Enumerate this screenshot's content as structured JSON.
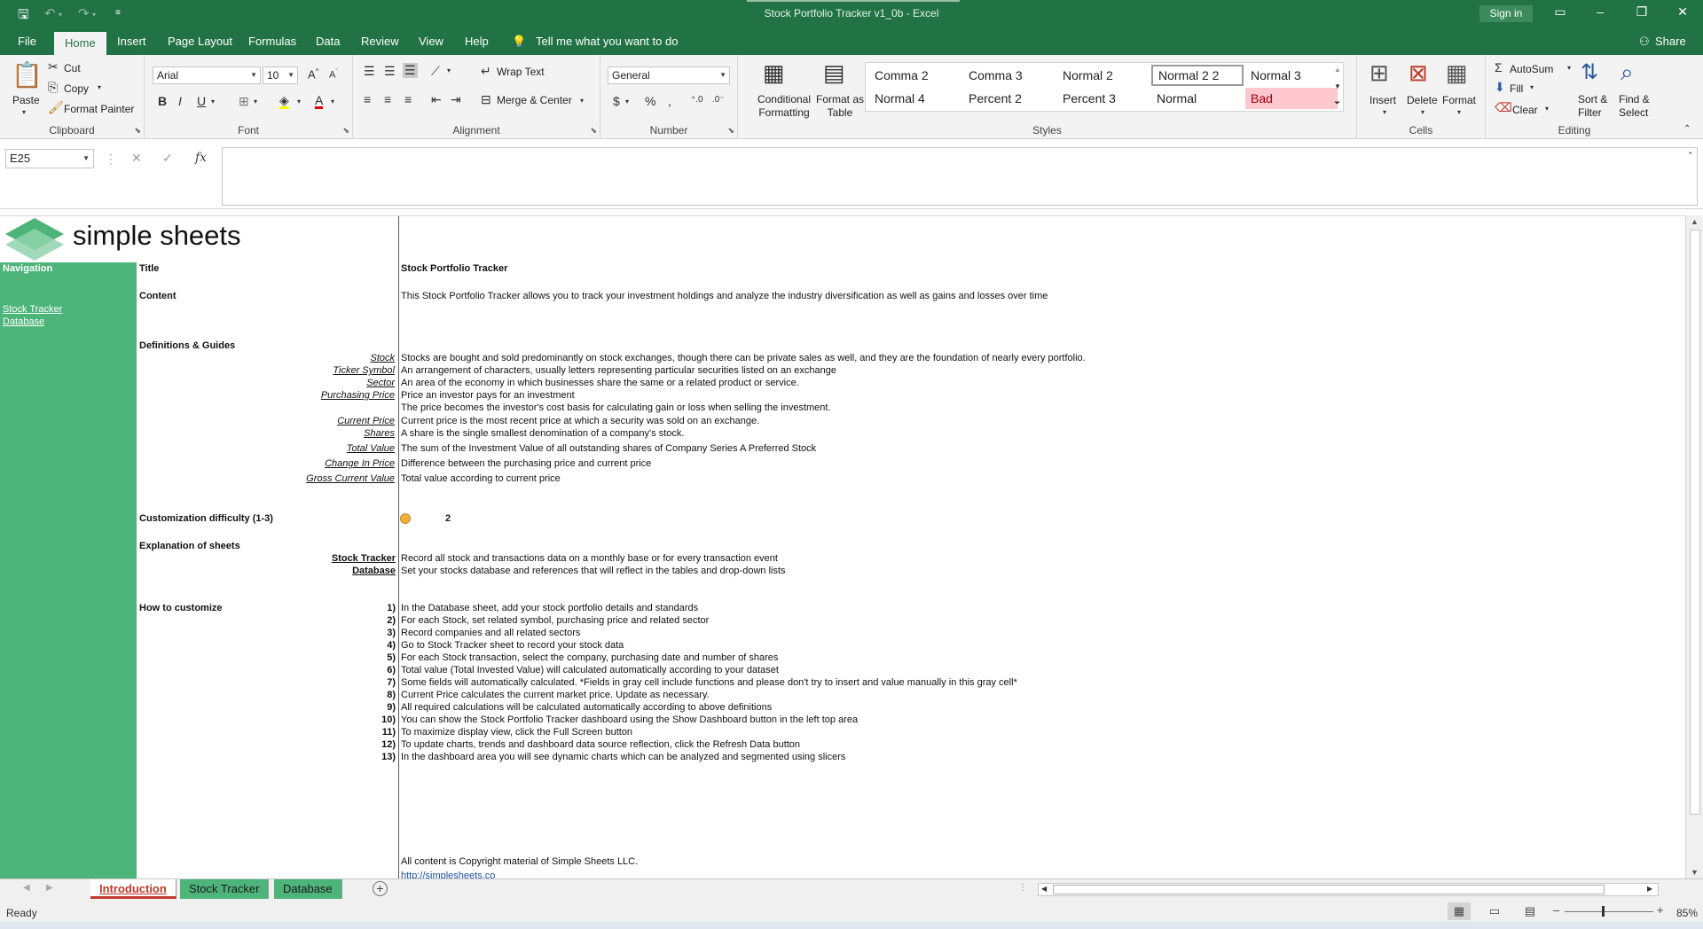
{
  "window": {
    "title": "Stock Portfolio Tracker v1_0b  -  Excel",
    "signin": "Sign in"
  },
  "tabs": [
    "File",
    "Home",
    "Insert",
    "Page Layout",
    "Formulas",
    "Data",
    "Review",
    "View",
    "Help"
  ],
  "tell_me": "Tell me what you want to do",
  "share": "Share",
  "ribbon": {
    "clipboard": {
      "paste": "Paste",
      "cut": "Cut",
      "copy": "Copy",
      "format_painter": "Format Painter",
      "label": "Clipboard"
    },
    "font": {
      "name": "Arial",
      "size": "10",
      "label": "Font"
    },
    "alignment": {
      "wrap_text": "Wrap Text",
      "merge_center": "Merge & Center",
      "label": "Alignment"
    },
    "number": {
      "format": "General",
      "label": "Number"
    },
    "styles": {
      "conditional": "Conditional Formatting",
      "format_table": "Format as Table",
      "items": [
        "Comma 2",
        "Comma 3",
        "Normal 2",
        "Normal 2 2",
        "Normal 3",
        "Normal 4",
        "Percent 2",
        "Percent 3",
        "Normal",
        "Bad"
      ],
      "label": "Styles"
    },
    "cells": {
      "insert": "Insert",
      "delete": "Delete",
      "format": "Format",
      "label": "Cells"
    },
    "editing": {
      "autosum": "AutoSum",
      "fill": "Fill",
      "clear": "Clear",
      "sort_filter": "Sort & Filter",
      "find_select": "Find & Select",
      "label": "Editing"
    }
  },
  "formula_bar": {
    "name_box": "E25",
    "formula": ""
  },
  "sheet": {
    "brand": "simple sheets",
    "navigation": {
      "heading": "Navigation",
      "links": [
        "Stock Tracker",
        "Database"
      ]
    },
    "title_label": "Title",
    "title_value": "Stock Portfolio Tracker",
    "content_label": "Content",
    "content_value": "This Stock Portfolio Tracker allows you to track your investment holdings and analyze the industry diversification as well as gains and losses over time",
    "definitions_label": "Definitions & Guides",
    "definitions": [
      {
        "term": "Stock",
        "text": "Stocks are bought and sold predominantly on stock exchanges, though there can be private sales as well, and they are the foundation of nearly every portfolio."
      },
      {
        "term": "Ticker Symbol",
        "text": "An arrangement of characters, usually letters representing particular securities listed on an exchange"
      },
      {
        "term": "Sector",
        "text": "An area of the economy in which businesses share the same or a related product or service."
      },
      {
        "term": "Purchasing Price",
        "text": "Price an investor pays for an investment"
      },
      {
        "term": "",
        "text": "The price becomes the investor's cost basis for calculating gain or loss when selling the investment."
      },
      {
        "term": "Current Price",
        "text": "Current price is the most recent price at which a security was sold on an exchange."
      },
      {
        "term": "Shares",
        "text": "A share is the single smallest denomination of a company's stock."
      },
      {
        "term": "Total Value",
        "text": "The sum of the Investment Value of all outstanding shares of Company Series A Preferred Stock"
      },
      {
        "term": "Change In Price",
        "text": "Difference between the purchasing price and current price"
      },
      {
        "term": "Gross Current Value",
        "text": "Total value according to current price"
      }
    ],
    "difficulty_label": "Customization difficulty (1-3)",
    "difficulty_value": "2",
    "explanation_label": "Explanation of sheets",
    "explanations": [
      {
        "sheet": "Stock Tracker",
        "text": "Record all stock and transactions data on a monthly base or for every transaction event"
      },
      {
        "sheet": "Database",
        "text": "Set your stocks database and references that will reflect in the tables and drop-down lists"
      }
    ],
    "howto_label": "How to customize",
    "steps": [
      {
        "n": "1)",
        "text": "In the Database sheet, add your stock portfolio details and standards"
      },
      {
        "n": "2)",
        "text": "For each Stock, set related symbol, purchasing price and related sector"
      },
      {
        "n": "3)",
        "text": "Record companies and all related sectors"
      },
      {
        "n": "4)",
        "text": "Go to Stock Tracker sheet to record your stock data"
      },
      {
        "n": "5)",
        "text": "For each Stock transaction, select  the company, purchasing date and number of shares"
      },
      {
        "n": "6)",
        "text": "Total value (Total Invested Value) will calculated automatically according to your dataset"
      },
      {
        "n": "7)",
        "text": "Some fields will automatically calculated. *Fields in gray cell include functions and please don't try to insert and value manually in this gray cell*"
      },
      {
        "n": "8)",
        "text": "Current Price calculates the current market price. Update as necessary."
      },
      {
        "n": "9)",
        "text": "All required calculations will be calculated automatically according to above definitions"
      },
      {
        "n": "10)",
        "text": "You can show the Stock Portfolio Tracker dashboard using the Show Dashboard button in the left top area"
      },
      {
        "n": "11)",
        "text": "To maximize display view, click the Full Screen button"
      },
      {
        "n": "12)",
        "text": "To update charts, trends and dashboard data source reflection, click the Refresh Data button"
      },
      {
        "n": "13)",
        "text": "In the dashboard area you will see dynamic charts which can be analyzed and segmented using slicers"
      }
    ],
    "copyright": "All content is Copyright material of Simple Sheets LLC.",
    "url": "http://simplesheets.co"
  },
  "sheet_tabs": [
    "Introduction",
    "Stock Tracker",
    "Database"
  ],
  "status": {
    "ready": "Ready",
    "zoom": "85%"
  },
  "colors": {
    "excel_green": "#217346",
    "nav_green": "#4db47a",
    "bad_fill": "#ffc7ce",
    "bad_text": "#9c0006",
    "difficulty_dot": "#f0b040"
  }
}
